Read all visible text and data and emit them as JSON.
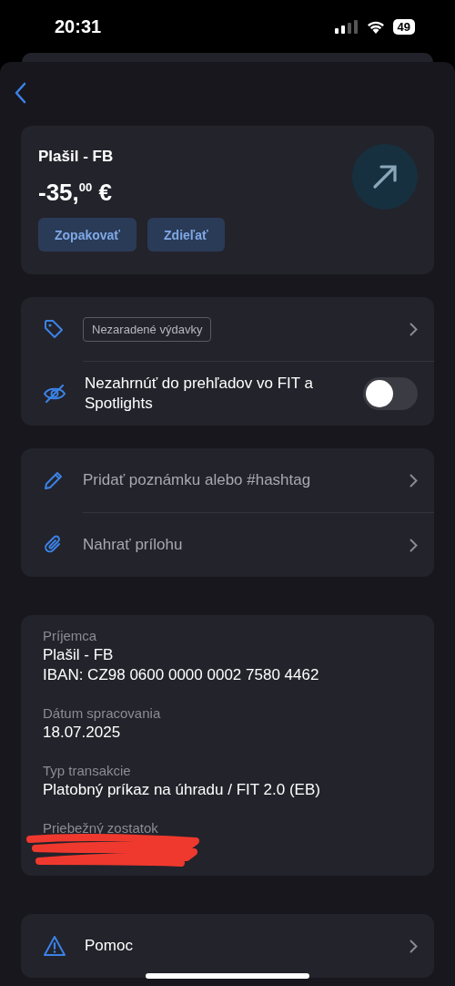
{
  "status_bar": {
    "time": "20:31",
    "battery": "49"
  },
  "header": {
    "title": "Plašil - FB",
    "amount": "-35,$^{00}$ €",
    "buttons": [
      "Zopakovať",
      "Zdieľať"
    ]
  },
  "settings": {
    "category": "Nezaradené výdavky",
    "exclude_label": "Nezahrnúť do prehľadov vo FIT a Spotlights",
    "exclude_on": false
  },
  "actions": [
    {
      "kind": "note",
      "label": "Pridať poznámku alebo #hashtag"
    },
    {
      "kind": "attachment",
      "label": "Nahrať prílohu"
    }
  ],
  "details": [
    {
      "label": "Príjemca",
      "values": [
        "Plašil - FB",
        "IBAN: CZ98 0600 0000 0002 7580 4462"
      ]
    },
    {
      "label": "Dátum spracovania",
      "values": [
        "18.07.2025"
      ]
    },
    {
      "label": "Typ transakcie",
      "values": [
        "Platobný príkaz na úhradu / FIT 2.0 (EB)"
      ]
    },
    {
      "label": "Priebežný zostatok",
      "kind": "redacted"
    }
  ],
  "help": {
    "label": "Pomoc"
  }
}
